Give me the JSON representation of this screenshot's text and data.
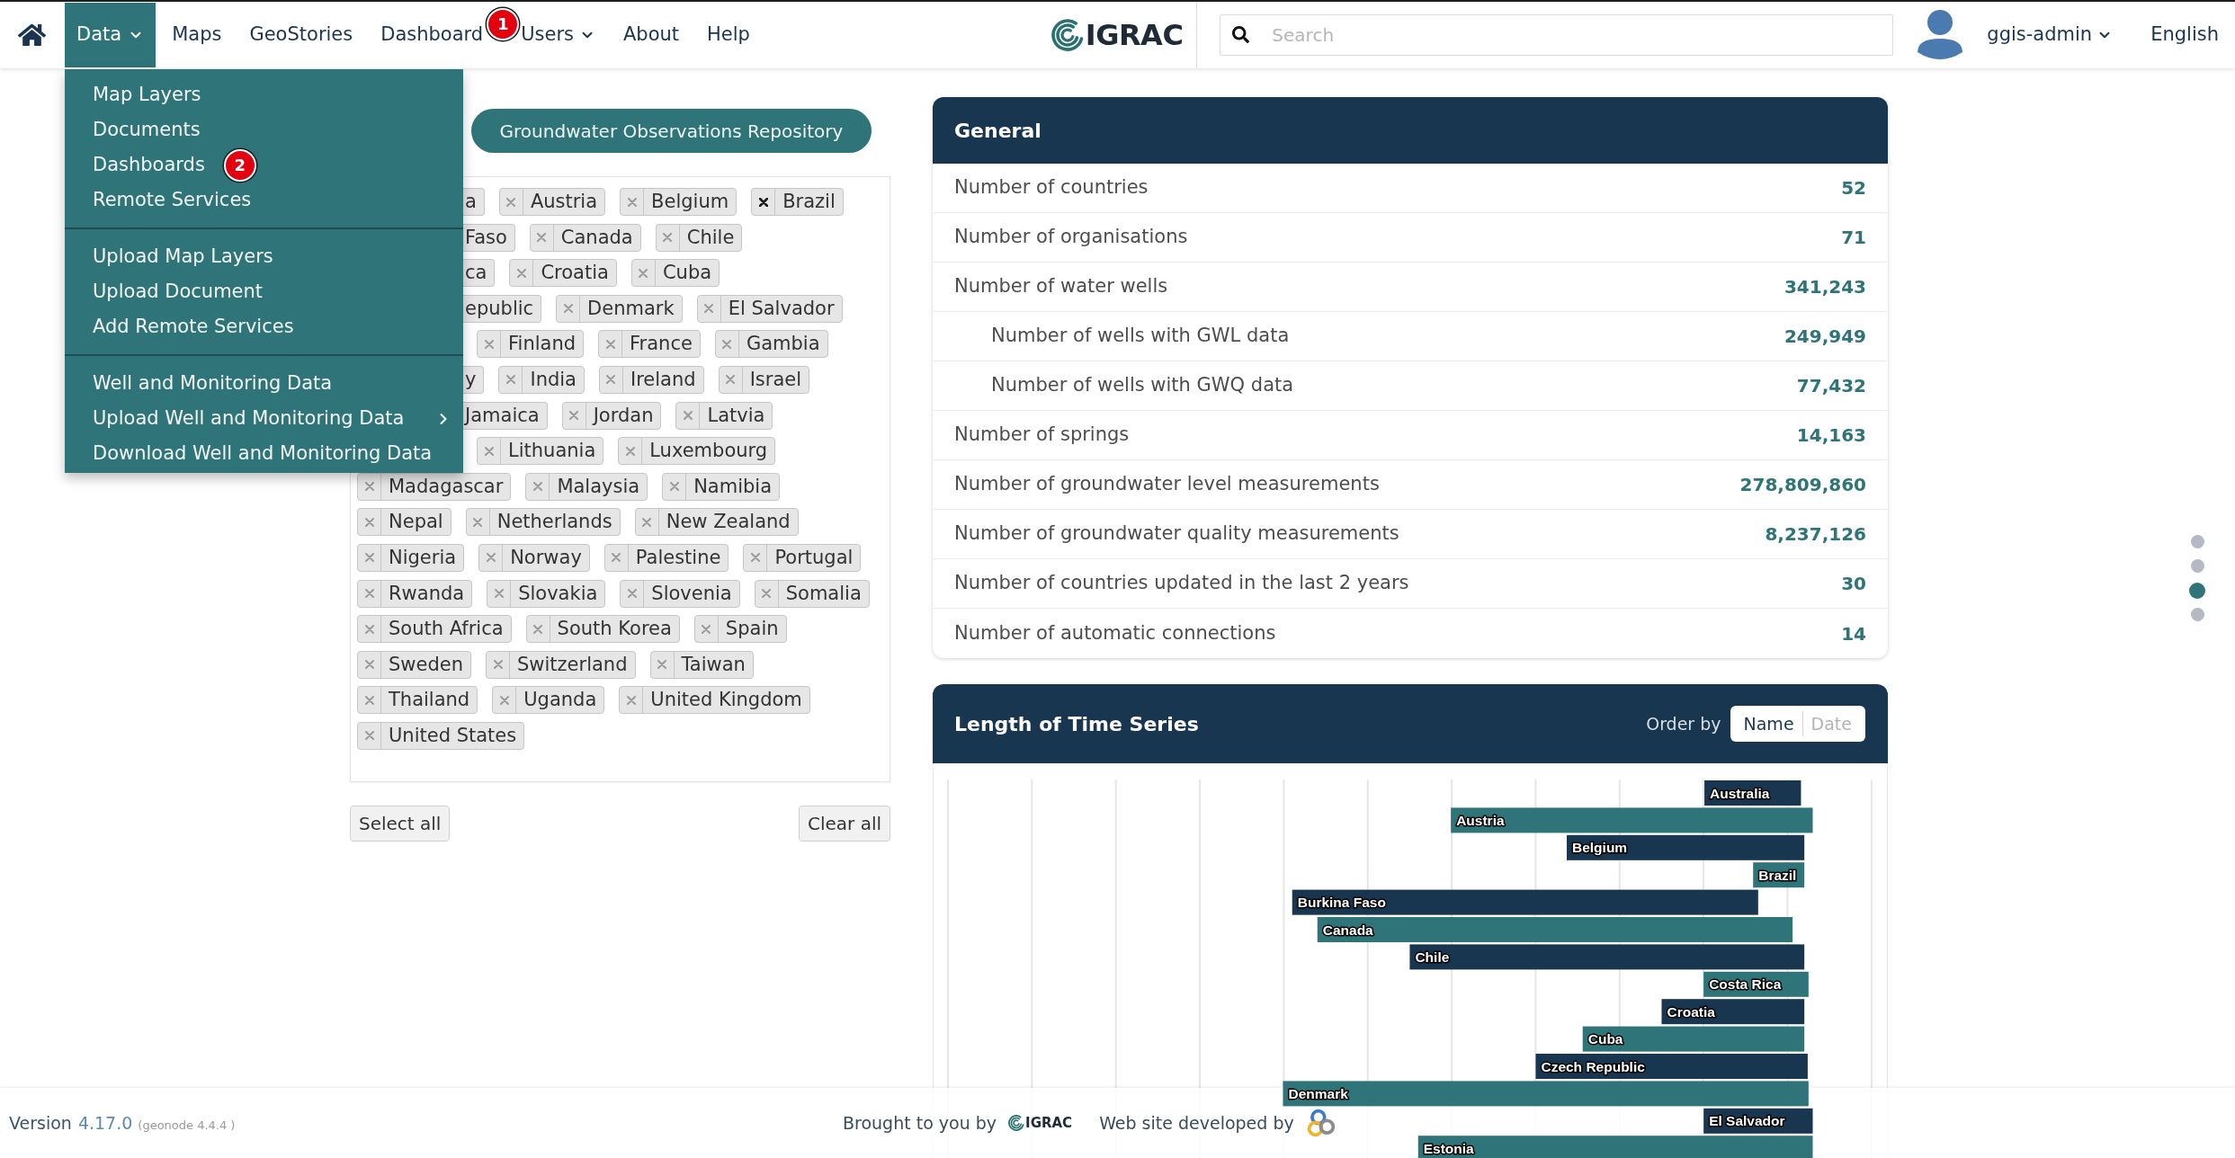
{
  "navbar": {
    "items": [
      {
        "kind": "dropdown",
        "label": "Data",
        "expanded": true
      },
      {
        "kind": "link",
        "label": "Maps"
      },
      {
        "kind": "link",
        "label": "GeoStories"
      },
      {
        "kind": "link",
        "label": "Dashboard",
        "marker": "1"
      },
      {
        "kind": "dropdown",
        "label": "Users",
        "expanded": false
      },
      {
        "kind": "link",
        "label": "About"
      },
      {
        "kind": "link",
        "label": "Help"
      }
    ],
    "logo_text": "IGRAC",
    "search_placeholder": "Search",
    "user": "ggis-admin",
    "language": "English"
  },
  "data_menu": {
    "sections": [
      {
        "items": [
          {
            "label": "Map Layers"
          },
          {
            "label": "Documents"
          },
          {
            "label": "Dashboards",
            "marker": "2"
          },
          {
            "label": "Remote Services"
          }
        ]
      },
      {
        "items": [
          {
            "label": "Upload Map Layers"
          },
          {
            "label": "Upload Document"
          },
          {
            "label": "Add Remote Services"
          }
        ]
      },
      {
        "items": [
          {
            "label": "Well and Monitoring Data"
          },
          {
            "label": "Upload Well and Monitoring Data",
            "submenu": true
          },
          {
            "label": "Download Well and Monitoring Data"
          }
        ]
      }
    ]
  },
  "repository_button": "Groundwater Observations Repository",
  "country_filter": {
    "rows_under_menu": [
      {
        "tags": [
          {
            "kind": "clipped",
            "label": "a"
          },
          {
            "kind": "tag",
            "label": "Austria",
            "hovered": false
          },
          {
            "kind": "tag",
            "label": "Belgium",
            "hovered": false
          },
          {
            "kind": "tag",
            "label": "Brazil",
            "hovered": true
          }
        ]
      },
      {
        "tags": [
          {
            "kind": "clipped",
            "label": "Faso"
          },
          {
            "kind": "tag",
            "label": "Canada",
            "hovered": false
          },
          {
            "kind": "tag",
            "label": "Chile",
            "hovered": false
          }
        ]
      },
      {
        "tags": [
          {
            "kind": "clipped",
            "label": "ca"
          },
          {
            "kind": "tag",
            "label": "Croatia",
            "hovered": false
          },
          {
            "kind": "tag",
            "label": "Cuba",
            "hovered": false
          }
        ]
      },
      {
        "tags": [
          {
            "kind": "clipped",
            "label": "epublic"
          },
          {
            "kind": "tag",
            "label": "Denmark",
            "hovered": false
          },
          {
            "kind": "tag",
            "label": "El Salvador",
            "hovered": false
          }
        ]
      },
      {
        "tags": [
          {
            "kind": "tag",
            "label": "Finland",
            "hovered": false
          },
          {
            "kind": "tag",
            "label": "France",
            "hovered": false
          },
          {
            "kind": "tag",
            "label": "Gambia",
            "hovered": false
          }
        ]
      },
      {
        "tags": [
          {
            "kind": "clipped",
            "label": "y"
          },
          {
            "kind": "tag",
            "label": "India",
            "hovered": false
          },
          {
            "kind": "tag",
            "label": "Ireland",
            "hovered": false
          },
          {
            "kind": "tag",
            "label": "Israel",
            "hovered": false
          }
        ]
      },
      {
        "tags": [
          {
            "kind": "clipped",
            "label": "Jamaica"
          },
          {
            "kind": "tag",
            "label": "Jordan",
            "hovered": false
          },
          {
            "kind": "tag",
            "label": "Latvia",
            "hovered": false
          }
        ]
      },
      {
        "tags": [
          {
            "kind": "tag",
            "label": "Lithuania",
            "hovered": false
          },
          {
            "kind": "tag",
            "label": "Luxembourg",
            "hovered": false
          }
        ]
      }
    ],
    "rows": [
      {
        "tags": [
          {
            "kind": "tag",
            "label": "Madagascar",
            "hovered": false
          },
          {
            "kind": "tag",
            "label": "Malaysia",
            "hovered": false
          },
          {
            "kind": "tag",
            "label": "Namibia",
            "hovered": false
          }
        ]
      },
      {
        "tags": [
          {
            "kind": "tag",
            "label": "Nepal",
            "hovered": false
          },
          {
            "kind": "tag",
            "label": "Netherlands",
            "hovered": false
          },
          {
            "kind": "tag",
            "label": "New Zealand",
            "hovered": false
          }
        ]
      },
      {
        "tags": [
          {
            "kind": "tag",
            "label": "Nigeria",
            "hovered": false
          },
          {
            "kind": "tag",
            "label": "Norway",
            "hovered": false
          },
          {
            "kind": "tag",
            "label": "Palestine",
            "hovered": false
          },
          {
            "kind": "tag",
            "label": "Portugal",
            "hovered": false
          }
        ]
      },
      {
        "tags": [
          {
            "kind": "tag",
            "label": "Rwanda",
            "hovered": false
          },
          {
            "kind": "tag",
            "label": "Slovakia",
            "hovered": false
          },
          {
            "kind": "tag",
            "label": "Slovenia",
            "hovered": false
          },
          {
            "kind": "tag",
            "label": "Somalia",
            "hovered": false
          }
        ]
      },
      {
        "tags": [
          {
            "kind": "tag",
            "label": "South Africa",
            "hovered": false
          },
          {
            "kind": "tag",
            "label": "South Korea",
            "hovered": false
          },
          {
            "kind": "tag",
            "label": "Spain",
            "hovered": false
          }
        ]
      },
      {
        "tags": [
          {
            "kind": "tag",
            "label": "Sweden",
            "hovered": false
          },
          {
            "kind": "tag",
            "label": "Switzerland",
            "hovered": false
          },
          {
            "kind": "tag",
            "label": "Taiwan",
            "hovered": false
          }
        ]
      },
      {
        "tags": [
          {
            "kind": "tag",
            "label": "Thailand",
            "hovered": false
          },
          {
            "kind": "tag",
            "label": "Uganda",
            "hovered": false
          },
          {
            "kind": "tag",
            "label": "United Kingdom",
            "hovered": false
          }
        ]
      },
      {
        "tags": [
          {
            "kind": "tag",
            "label": "United States",
            "hovered": false
          }
        ]
      }
    ],
    "buttons": [
      "Select all",
      "Clear all"
    ]
  },
  "general": {
    "title": "General",
    "rows": [
      {
        "label": "Number of countries",
        "value": "52"
      },
      {
        "label": "Number of organisations",
        "value": "71"
      },
      {
        "label": "Number of water wells",
        "value": "341,243",
        "children": [
          {
            "label": "Number of wells with GWL data",
            "value": "249,949"
          },
          {
            "label": "Number of wells with GWQ data",
            "value": "77,432"
          }
        ]
      },
      {
        "label": "Number of springs",
        "value": "14,163"
      },
      {
        "label": "Number of groundwater level measurements",
        "value": "278,809,860"
      },
      {
        "label": "Number of groundwater quality measurements",
        "value": "8,237,126"
      },
      {
        "label": "Number of countries updated in the last 2 years",
        "value": "30"
      },
      {
        "label": "Number of automatic connections",
        "value": "14"
      }
    ]
  },
  "time_series": {
    "title": "Length of Time Series",
    "order_by": {
      "label": "Order by",
      "options": [
        {
          "label": "Name",
          "selected": true
        },
        {
          "label": "Date",
          "selected": false
        }
      ]
    },
    "bars": [
      {
        "label": "Australia"
      },
      {
        "label": "Austria"
      },
      {
        "label": "Belgium"
      },
      {
        "label": "Brazil"
      },
      {
        "label": "Burkina Faso"
      },
      {
        "label": "Canada"
      },
      {
        "label": "Chile"
      },
      {
        "label": "Costa Rica"
      },
      {
        "label": "Croatia"
      },
      {
        "label": "Cuba"
      },
      {
        "label": "Czech Republic"
      },
      {
        "label": "Denmark"
      },
      {
        "label": "El Salvador"
      },
      {
        "label": "Estonia"
      }
    ]
  },
  "section_dots": [
    {
      "selected": false
    },
    {
      "selected": false
    },
    {
      "selected": true
    },
    {
      "selected": false
    }
  ],
  "footer": {
    "version_label": "Version",
    "version": "4.17.0",
    "geonode": "(geonode 4.4.4 )",
    "brought_by": "Brought to you by",
    "logo_text": "IGRAC",
    "developed_by": "Web site developed by"
  }
}
